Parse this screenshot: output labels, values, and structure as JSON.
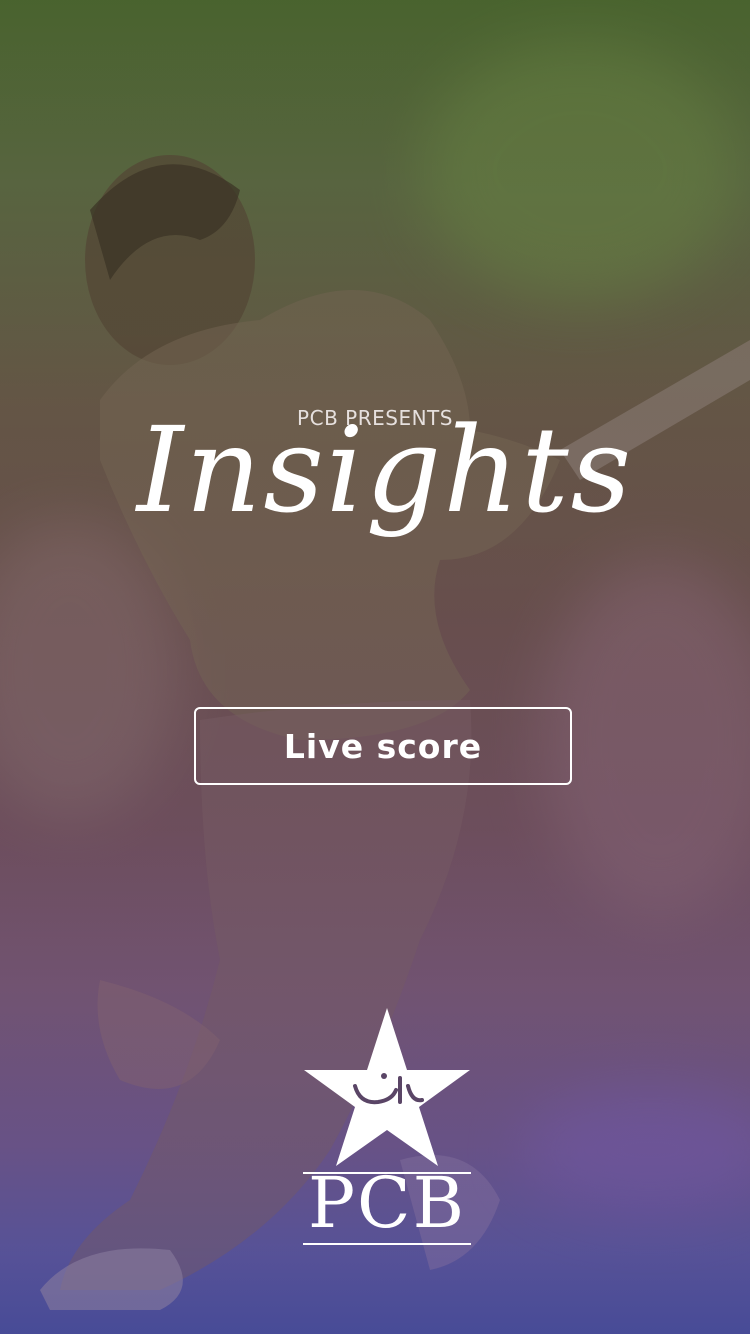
{
  "splash": {
    "presents": "PCB PRESENTS",
    "title": "Insights",
    "live_score_button": "Live score"
  },
  "logo": {
    "text": "PCB",
    "urdu_mark": "پاکستان"
  },
  "colors": {
    "top_tint": "#4f6a33",
    "middle_tint": "#6d5350",
    "bottom_tint": "#4a53a0",
    "text": "#ffffff"
  }
}
